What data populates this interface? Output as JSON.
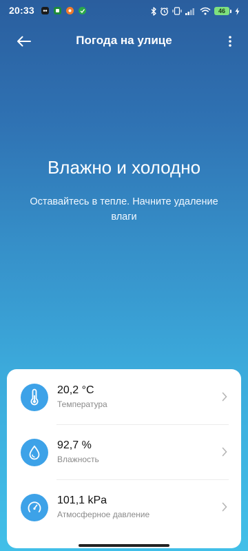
{
  "status_bar": {
    "time": "20:33",
    "battery_level": "46",
    "notification_icons": [
      "app-icon-1",
      "app-icon-2",
      "app-icon-3",
      "app-icon-4"
    ],
    "system_icons": [
      "bluetooth-icon",
      "alarm-icon",
      "vibrate-icon",
      "signal-icon",
      "wifi-icon",
      "battery-icon",
      "charging-icon"
    ]
  },
  "app_bar": {
    "title": "Погода на улице",
    "back_icon": "arrow-left-icon",
    "more_icon": "more-vertical-icon"
  },
  "hero": {
    "title": "Влажно и холодно",
    "subtitle": "Оставайтесь в тепле. Начните удаление влаги"
  },
  "metrics": [
    {
      "icon": "thermometer-icon",
      "value": "20,2 °C",
      "label": "Температура"
    },
    {
      "icon": "droplet-icon",
      "value": "92,7 %",
      "label": "Влажность"
    },
    {
      "icon": "gauge-icon",
      "value": "101,1 kPa",
      "label": "Атмосферное давление"
    }
  ],
  "colors": {
    "gradient_top": "#2a5e9e",
    "gradient_bottom": "#41bfe8",
    "icon_circle": "#3da2e8",
    "card_background": "#ffffff",
    "label_gray": "#8a8a8a"
  }
}
